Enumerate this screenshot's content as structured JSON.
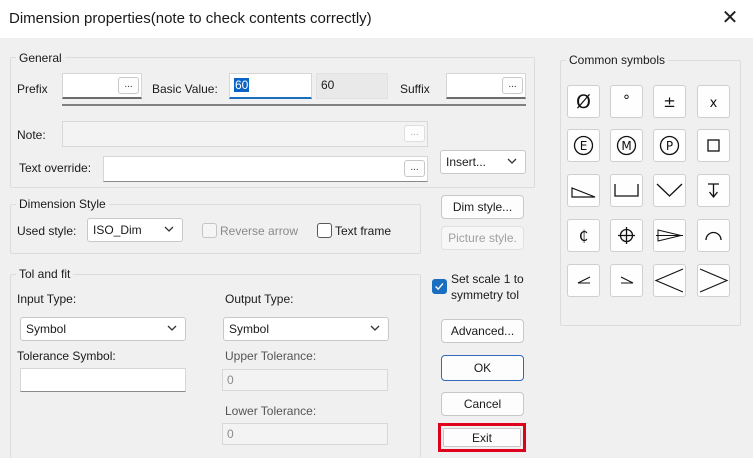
{
  "window": {
    "title": "Dimension properties(note to check contents correctly)",
    "close_glyph": "✕"
  },
  "general": {
    "legend": "General",
    "prefix_label": "Prefix",
    "prefix_value": "",
    "basic_value_label": "Basic Value:",
    "basic_value": "60",
    "basic_value_display": "60",
    "suffix_label": "Suffix",
    "suffix_value": "",
    "note_label": "Note:",
    "note_value": "",
    "text_override_label": "Text override:",
    "text_override_value": "",
    "ellipsis": "...",
    "insert_label": "Insert..."
  },
  "dimension_style": {
    "legend": "Dimension Style",
    "used_style_label": "Used style:",
    "used_style_value": "ISO_Dim",
    "reverse_arrow_label": "Reverse arrow",
    "reverse_arrow_checked": false,
    "text_frame_label": "Text frame",
    "text_frame_checked": false
  },
  "tol_and_fit": {
    "legend": "Tol and fit",
    "input_type_label": "Input Type:",
    "input_type_value": "Symbol",
    "output_type_label": "Output Type:",
    "output_type_value": "Symbol",
    "tolerance_symbol_label": "Tolerance Symbol:",
    "tolerance_symbol_value": "",
    "upper_tolerance_label": "Upper Tolerance:",
    "upper_tolerance_value": "0",
    "lower_tolerance_label": "Lower Tolerance:",
    "lower_tolerance_value": "0"
  },
  "actions": {
    "dim_style": "Dim style...",
    "picture_style": "Picture style.",
    "set_scale_line1": "Set scale 1 to",
    "set_scale_line2": "symmetry tol",
    "set_scale_checked": true,
    "advanced": "Advanced...",
    "ok": "OK",
    "cancel": "Cancel",
    "exit": "Exit"
  },
  "common_symbols": {
    "legend": "Common symbols",
    "items": [
      {
        "name": "diameter-icon",
        "text": "Ø"
      },
      {
        "name": "degree-icon",
        "text": "°"
      },
      {
        "name": "plus-minus-icon",
        "text": "±"
      },
      {
        "name": "multiply-icon",
        "text": "x"
      },
      {
        "name": "circled-e-icon",
        "text": "E"
      },
      {
        "name": "circled-m-icon",
        "text": "M"
      },
      {
        "name": "circled-p-icon",
        "text": "P"
      },
      {
        "name": "square-icon",
        "text": ""
      },
      {
        "name": "slope-icon",
        "text": ""
      },
      {
        "name": "counterbore-icon",
        "text": ""
      },
      {
        "name": "countersink-icon",
        "text": ""
      },
      {
        "name": "depth-icon",
        "text": ""
      },
      {
        "name": "centerline-icon",
        "text": "₵"
      },
      {
        "name": "crosshair-icon",
        "text": ""
      },
      {
        "name": "conical-taper-icon",
        "text": ""
      },
      {
        "name": "arc-icon",
        "text": ""
      },
      {
        "name": "small-angle-left-icon",
        "text": ""
      },
      {
        "name": "small-angle-right-icon",
        "text": ""
      },
      {
        "name": "large-angle-left-icon",
        "text": ""
      },
      {
        "name": "large-angle-right-icon",
        "text": ""
      }
    ]
  },
  "colors": {
    "accent": "#1a6ec0",
    "selection": "#0a64c6",
    "exit_highlight": "#e0001b"
  }
}
